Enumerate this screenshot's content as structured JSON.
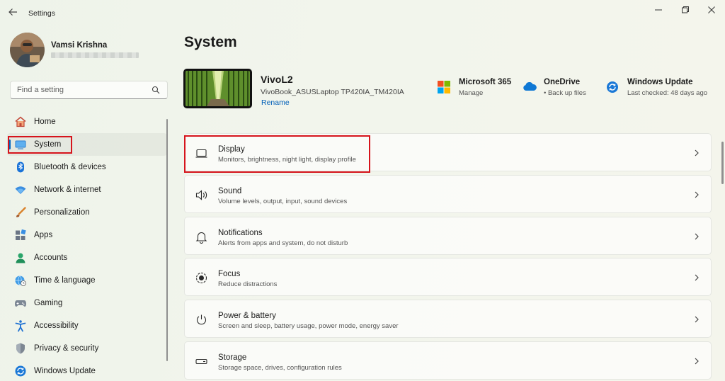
{
  "app": {
    "title": "Settings"
  },
  "user": {
    "name": "Vamsi Krishna"
  },
  "search": {
    "placeholder": "Find a setting"
  },
  "sidebar": {
    "items": [
      {
        "label": "Home",
        "icon": "home-icon"
      },
      {
        "label": "System",
        "icon": "system-icon",
        "active": true
      },
      {
        "label": "Bluetooth & devices",
        "icon": "bluetooth-icon"
      },
      {
        "label": "Network & internet",
        "icon": "network-icon"
      },
      {
        "label": "Personalization",
        "icon": "brush-icon"
      },
      {
        "label": "Apps",
        "icon": "apps-icon"
      },
      {
        "label": "Accounts",
        "icon": "accounts-icon"
      },
      {
        "label": "Time & language",
        "icon": "globe-clock-icon"
      },
      {
        "label": "Gaming",
        "icon": "gamepad-icon"
      },
      {
        "label": "Accessibility",
        "icon": "accessibility-icon"
      },
      {
        "label": "Privacy & security",
        "icon": "shield-icon"
      },
      {
        "label": "Windows Update",
        "icon": "update-icon"
      }
    ]
  },
  "main": {
    "title": "System",
    "device": {
      "name": "VivoL2",
      "model": "VivoBook_ASUSLaptop TP420IA_TM420IA",
      "rename": "Rename"
    },
    "quick": [
      {
        "title": "Microsoft 365",
        "sub": "Manage",
        "icon": "microsoft-365-icon"
      },
      {
        "title": "OneDrive",
        "sub": "• Back up files",
        "icon": "onedrive-icon"
      },
      {
        "title": "Windows Update",
        "sub": "Last checked: 48 days ago",
        "icon": "windows-update-icon"
      }
    ],
    "cards": [
      {
        "title": "Display",
        "sub": "Monitors, brightness, night light, display profile",
        "icon": "display-icon"
      },
      {
        "title": "Sound",
        "sub": "Volume levels, output, input, sound devices",
        "icon": "speaker-icon"
      },
      {
        "title": "Notifications",
        "sub": "Alerts from apps and system, do not disturb",
        "icon": "bell-icon"
      },
      {
        "title": "Focus",
        "sub": "Reduce distractions",
        "icon": "focus-icon"
      },
      {
        "title": "Power & battery",
        "sub": "Screen and sleep, battery usage, power mode, energy saver",
        "icon": "power-icon"
      },
      {
        "title": "Storage",
        "sub": "Storage space, drives, configuration rules",
        "icon": "storage-icon"
      }
    ]
  },
  "colors": {
    "accent": "#0067c0",
    "highlight": "#d6141c"
  }
}
